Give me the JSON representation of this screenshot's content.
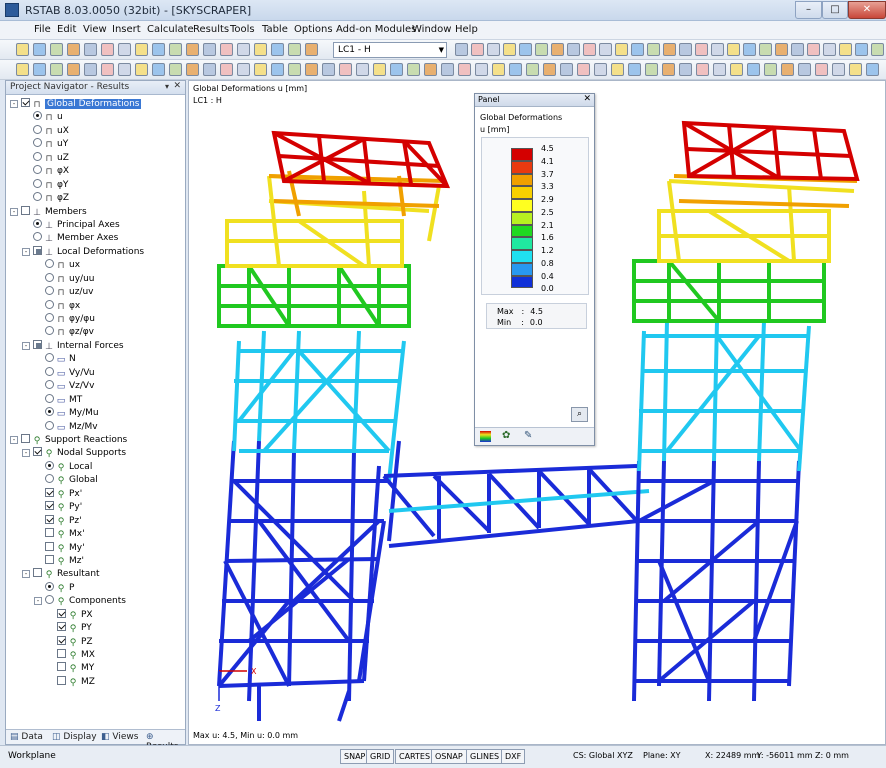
{
  "window": {
    "title": "RSTAB 8.03.0050 (32bit) - [SKYSCRAPER]",
    "min": "–",
    "max": "□",
    "close": "✕"
  },
  "menu": [
    "File",
    "Edit",
    "View",
    "Insert",
    "Calculate",
    "Results",
    "Tools",
    "Table",
    "Options",
    "Add-on Modules",
    "Window",
    "Help"
  ],
  "toolbar": {
    "loadcase": "LC1 - H"
  },
  "navigator": {
    "title": "Project Navigator - Results",
    "items": [
      {
        "label": "Global Deformations",
        "kind": "check",
        "state": "on",
        "expand": "-",
        "indent": 0,
        "icon": "deformation-icon",
        "selected": true
      },
      {
        "label": "u",
        "kind": "radio",
        "state": "on",
        "indent": 1,
        "icon": "deformation-icon"
      },
      {
        "label": "uX",
        "kind": "radio",
        "state": "off",
        "indent": 1,
        "icon": "deformation-icon"
      },
      {
        "label": "uY",
        "kind": "radio",
        "state": "off",
        "indent": 1,
        "icon": "deformation-icon"
      },
      {
        "label": "uZ",
        "kind": "radio",
        "state": "off",
        "indent": 1,
        "icon": "deformation-icon"
      },
      {
        "label": "φX",
        "kind": "radio",
        "state": "off",
        "indent": 1,
        "icon": "deformation-icon"
      },
      {
        "label": "φY",
        "kind": "radio",
        "state": "off",
        "indent": 1,
        "icon": "deformation-icon"
      },
      {
        "label": "φZ",
        "kind": "radio",
        "state": "off",
        "indent": 1,
        "icon": "deformation-icon"
      },
      {
        "label": "Members",
        "kind": "check",
        "state": "off",
        "expand": "-",
        "indent": 0,
        "icon": "members-icon"
      },
      {
        "label": "Principal Axes",
        "kind": "radio",
        "state": "on",
        "indent": 1,
        "icon": "axes-icon"
      },
      {
        "label": "Member Axes",
        "kind": "radio",
        "state": "off",
        "indent": 1,
        "icon": "axes-icon"
      },
      {
        "label": "Local Deformations",
        "kind": "check",
        "state": "part",
        "expand": "-",
        "indent": 1,
        "icon": "members-icon"
      },
      {
        "label": "ux",
        "kind": "radio",
        "state": "off",
        "indent": 2,
        "icon": "deformation-icon"
      },
      {
        "label": "uy/uu",
        "kind": "radio",
        "state": "off",
        "indent": 2,
        "icon": "deformation-icon"
      },
      {
        "label": "uz/uv",
        "kind": "radio",
        "state": "off",
        "indent": 2,
        "icon": "deformation-icon"
      },
      {
        "label": "φx",
        "kind": "radio",
        "state": "off",
        "indent": 2,
        "icon": "deformation-icon"
      },
      {
        "label": "φy/φu",
        "kind": "radio",
        "state": "off",
        "indent": 2,
        "icon": "deformation-icon"
      },
      {
        "label": "φz/φv",
        "kind": "radio",
        "state": "off",
        "indent": 2,
        "icon": "deformation-icon"
      },
      {
        "label": "Internal Forces",
        "kind": "check",
        "state": "part",
        "expand": "-",
        "indent": 1,
        "icon": "members-icon"
      },
      {
        "label": "N",
        "kind": "radio",
        "state": "off",
        "indent": 2,
        "icon": "force-icon"
      },
      {
        "label": "Vy/Vu",
        "kind": "radio",
        "state": "off",
        "indent": 2,
        "icon": "force-icon"
      },
      {
        "label": "Vz/Vv",
        "kind": "radio",
        "state": "off",
        "indent": 2,
        "icon": "force-icon"
      },
      {
        "label": "MT",
        "kind": "radio",
        "state": "off",
        "indent": 2,
        "icon": "force-icon"
      },
      {
        "label": "My/Mu",
        "kind": "radio",
        "state": "on",
        "indent": 2,
        "icon": "force-icon"
      },
      {
        "label": "Mz/Mv",
        "kind": "radio",
        "state": "off",
        "indent": 2,
        "icon": "force-icon"
      },
      {
        "label": "Support Reactions",
        "kind": "check",
        "state": "off",
        "expand": "-",
        "indent": 0,
        "icon": "support-icon"
      },
      {
        "label": "Nodal Supports",
        "kind": "check",
        "state": "on",
        "expand": "-",
        "indent": 1,
        "icon": "support-icon"
      },
      {
        "label": "Local",
        "kind": "radio",
        "state": "on",
        "indent": 2,
        "icon": "support-icon"
      },
      {
        "label": "Global",
        "kind": "radio",
        "state": "off",
        "indent": 2,
        "icon": "support-icon"
      },
      {
        "label": "Px'",
        "kind": "check",
        "state": "on",
        "indent": 2,
        "icon": "support-icon"
      },
      {
        "label": "Py'",
        "kind": "check",
        "state": "on",
        "indent": 2,
        "icon": "support-icon"
      },
      {
        "label": "Pz'",
        "kind": "check",
        "state": "on",
        "indent": 2,
        "icon": "support-icon"
      },
      {
        "label": "Mx'",
        "kind": "check",
        "state": "off",
        "indent": 2,
        "icon": "support-icon"
      },
      {
        "label": "My'",
        "kind": "check",
        "state": "off",
        "indent": 2,
        "icon": "support-icon"
      },
      {
        "label": "Mz'",
        "kind": "check",
        "state": "off",
        "indent": 2,
        "icon": "support-icon"
      },
      {
        "label": "Resultant",
        "kind": "check",
        "state": "off",
        "expand": "-",
        "indent": 1,
        "icon": "support-icon"
      },
      {
        "label": "P",
        "kind": "radio",
        "state": "on",
        "indent": 2,
        "icon": "support-icon"
      },
      {
        "label": "Components",
        "kind": "radio",
        "state": "off",
        "expand": "-",
        "indent": 2,
        "icon": "support-icon"
      },
      {
        "label": "PX",
        "kind": "check",
        "state": "on",
        "indent": 3,
        "icon": "support-icon"
      },
      {
        "label": "PY",
        "kind": "check",
        "state": "on",
        "indent": 3,
        "icon": "support-icon"
      },
      {
        "label": "PZ",
        "kind": "check",
        "state": "on",
        "indent": 3,
        "icon": "support-icon"
      },
      {
        "label": "MX",
        "kind": "check",
        "state": "off",
        "indent": 3,
        "icon": "support-icon"
      },
      {
        "label": "MY",
        "kind": "check",
        "state": "off",
        "indent": 3,
        "icon": "support-icon"
      },
      {
        "label": "MZ",
        "kind": "check",
        "state": "off",
        "indent": 3,
        "icon": "support-icon"
      }
    ],
    "tabs": [
      "Data",
      "Display",
      "Views",
      "Results"
    ]
  },
  "view": {
    "info1": "Global Deformations u [mm]",
    "info2": "LC1 : H",
    "footer": "Max u: 4.5, Min u: 0.0 mm",
    "axis_x": "X",
    "axis_z": "Z"
  },
  "panel": {
    "title": "Panel",
    "close": "✕",
    "heading": "Global Deformations",
    "unit": "u [mm]",
    "legend": [
      {
        "value": "4.5",
        "color": "#d40000"
      },
      {
        "value": "4.1",
        "color": "#e83a10"
      },
      {
        "value": "3.7",
        "color": "#f0a000"
      },
      {
        "value": "3.3",
        "color": "#f8d000"
      },
      {
        "value": "2.9",
        "color": "#ffff20"
      },
      {
        "value": "2.5",
        "color": "#b8f020"
      },
      {
        "value": "2.1",
        "color": "#20d820"
      },
      {
        "value": "1.6",
        "color": "#20e8a0"
      },
      {
        "value": "1.2",
        "color": "#20e0f0"
      },
      {
        "value": "0.8",
        "color": "#2898f0"
      },
      {
        "value": "0.4",
        "color": "#1030d8"
      },
      {
        "value": "0.0",
        "color": "#0000a8"
      }
    ],
    "max_label": "Max",
    "max_value": "4.5",
    "min_label": "Min",
    "min_value": "0.0"
  },
  "statusbar": {
    "workplane": "Workplane",
    "toggles": [
      "SNAP",
      "GRID",
      "CARTES",
      "OSNAP",
      "GLINES",
      "DXF"
    ],
    "cs": "CS: Global XYZ",
    "plane": "Plane: XY",
    "x": "X:  22489 mm",
    "y": "Y:  -56011 mm",
    "z": "Z:  0 mm"
  }
}
